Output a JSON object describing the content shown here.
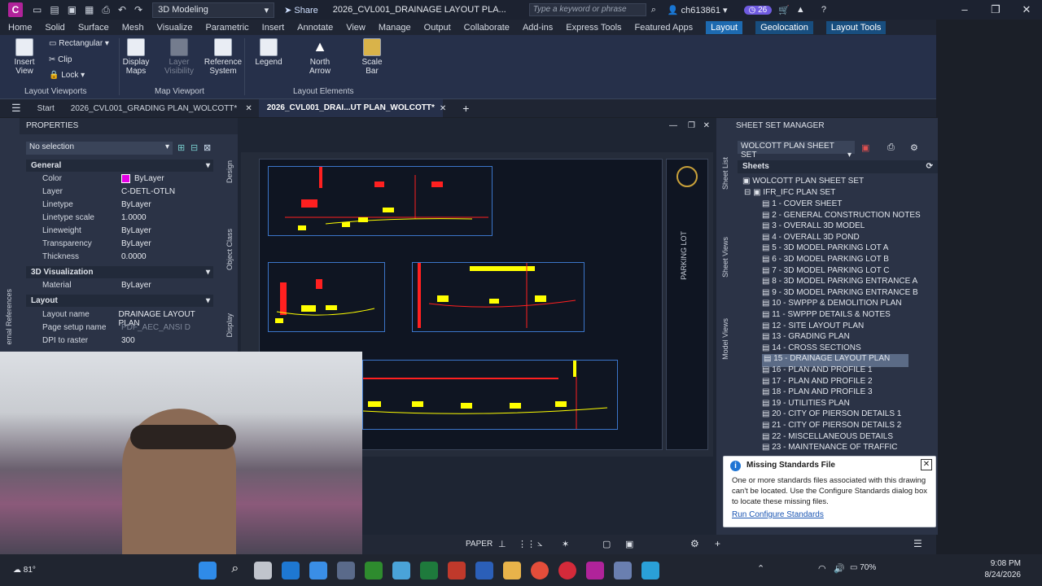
{
  "titlebar": {
    "logo": "C",
    "workspace": "3D Modeling",
    "share": "Share",
    "document": "2026_CVL001_DRAINAGE LAYOUT PLA...",
    "search_placeholder": "Type a keyword or phrase",
    "user": "ch613861",
    "badge": "26"
  },
  "menubar": [
    "Home",
    "Solid",
    "Surface",
    "Mesh",
    "Visualize",
    "Parametric",
    "Insert",
    "Annotate",
    "View",
    "Manage",
    "Output",
    "Collaborate",
    "Add-ins",
    "Express Tools",
    "Featured Apps",
    "Layout",
    "Geolocation",
    "Layout Tools"
  ],
  "ribbon": {
    "insert_view": "Insert View",
    "rectangular": "Rectangular",
    "clip": "Clip",
    "lock": "Lock",
    "display_maps_1": "Display",
    "display_maps_2": "Maps",
    "layer_visibility_1": "Layer",
    "layer_visibility_2": "Visibility",
    "reference_system_1": "Reference",
    "reference_system_2": "System",
    "legend": "Legend",
    "north_arrow_1": "North",
    "north_arrow_2": "Arrow",
    "scale_bar_1": "Scale",
    "scale_bar_2": "Bar",
    "panel_layout_viewports": "Layout Viewports",
    "panel_map_viewport": "Map Viewport",
    "panel_layout_elements": "Layout Elements"
  },
  "doctabs": {
    "start": "Start",
    "tab1": "2026_CVL001_GRADING PLAN_WOLCOTT*",
    "tab2": "2026_CVL001_DRAI...UT PLAN_WOLCOTT*"
  },
  "properties": {
    "title": "PROPERTIES",
    "selection": "No selection",
    "sections": {
      "general": "General",
      "viz": "3D Visualization",
      "layout": "Layout"
    },
    "general": [
      {
        "k": "Color",
        "v": "ByLayer"
      },
      {
        "k": "Layer",
        "v": "C-DETL-OTLN"
      },
      {
        "k": "Linetype",
        "v": "ByLayer"
      },
      {
        "k": "Linetype scale",
        "v": "1.0000"
      },
      {
        "k": "Lineweight",
        "v": "ByLayer"
      },
      {
        "k": "Transparency",
        "v": "ByLayer"
      },
      {
        "k": "Thickness",
        "v": "0.0000"
      }
    ],
    "viz": [
      {
        "k": "Material",
        "v": "ByLayer"
      }
    ],
    "layout": [
      {
        "k": "Layout name",
        "v": "DRAINAGE LAYOUT PLAN"
      },
      {
        "k": "Page setup name",
        "v": "PDF_AEC_ANSI D"
      },
      {
        "k": "DPI to raster",
        "v": "300"
      }
    ],
    "vtabs": [
      "Design",
      "Object Class",
      "Display"
    ],
    "left_vtab": "ernal References"
  },
  "ssm": {
    "title": "SHEET SET MANAGER",
    "set": "WOLCOTT PLAN SHEET SET",
    "sheets_header": "Sheets",
    "root": "WOLCOTT PLAN SHEET SET",
    "subset": "IFR_IFC PLAN SET",
    "items": [
      "1 - COVER SHEET",
      "2 - GENERAL CONSTRUCTION NOTES",
      "3 - OVERALL 3D MODEL",
      "4 - OVERALL 3D POND",
      "5 - 3D MODEL PARKING LOT A",
      "6 - 3D MODEL PARKING LOT B",
      "7 - 3D MODEL PARKING LOT C",
      "8 - 3D MODEL PARKING ENTRANCE A",
      "9 - 3D MODEL PARKING ENTRANCE B",
      "10 - SWPPP & DEMOLITION PLAN",
      "11 - SWPPP DETAILS & NOTES",
      "12 - SITE LAYOUT PLAN",
      "13 - GRADING PLAN",
      "14 - CROSS SECTIONS",
      "15 - DRAINAGE LAYOUT PLAN",
      "16 - PLAN AND PROFILE 1",
      "17 - PLAN AND PROFILE 2",
      "18 - PLAN AND PROFILE 3",
      "19 - UTILITIES PLAN",
      "20 - CITY OF PIERSON DETAILS 1",
      "21 - CITY OF PIERSON DETAILS 2",
      "22 - MISCELLANEOUS DETAILS",
      "23 - MAINTENANCE OF TRAFFIC"
    ],
    "selected_index": 14,
    "vtabs": [
      "Sheet List",
      "Sheet Views",
      "Model Views"
    ]
  },
  "popup": {
    "title": "Missing Standards File",
    "body": "One or more standards files associated with this drawing can't be located. Use the Configure Standards dialog box to locate these missing files.",
    "link": "Run Configure Standards"
  },
  "statusbar": {
    "paper": "PAPER"
  },
  "titleblock": {
    "text": "PARKING LOT"
  },
  "taskbar": {
    "weather": "81°",
    "time": "9:08 PM",
    "date": "8/24/2026",
    "battery": "70%"
  },
  "colors": {
    "accent": "#1d6ab0",
    "magenta": "#e600e6",
    "yellow": "#ffff00",
    "red": "#ff2020"
  }
}
